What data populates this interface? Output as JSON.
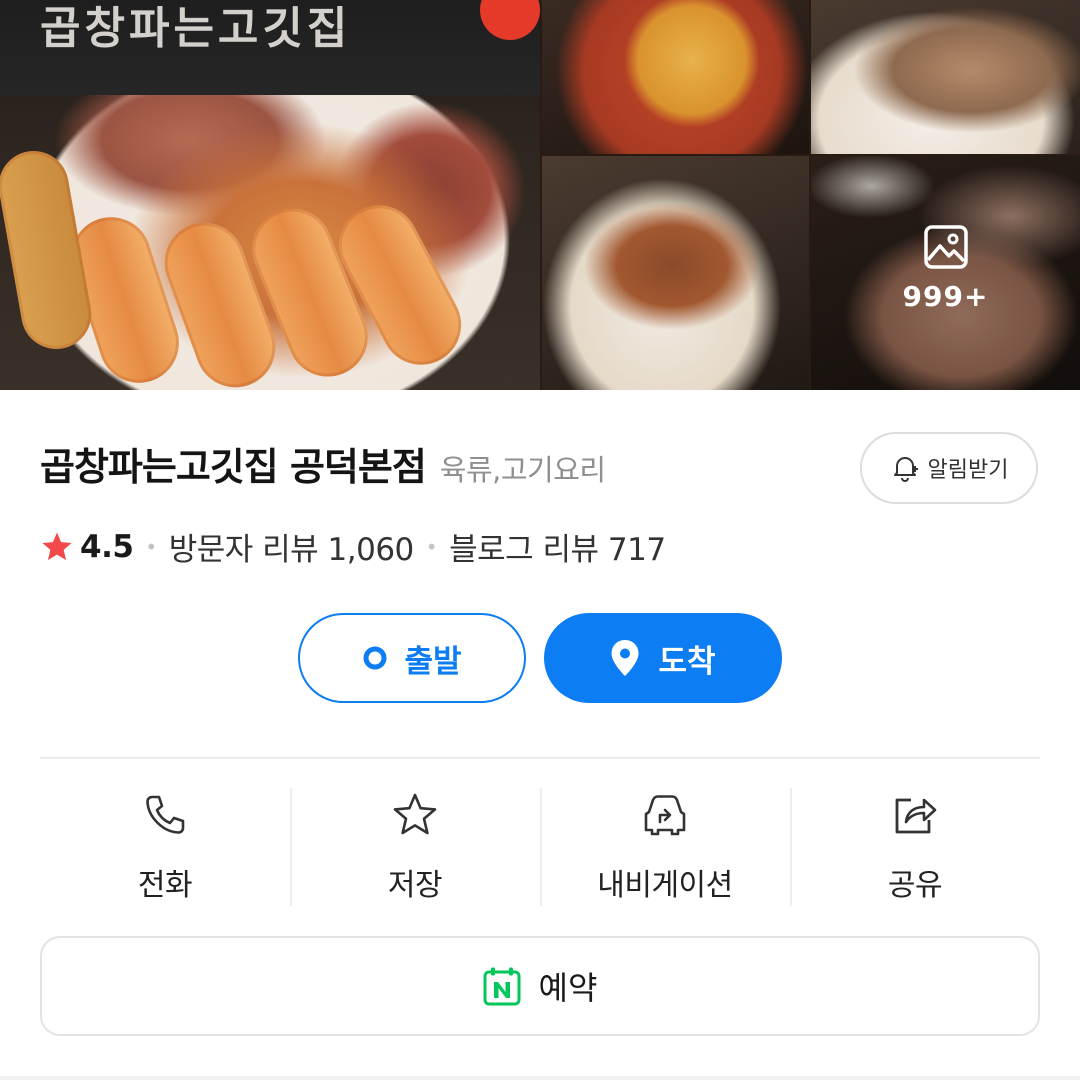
{
  "gallery": {
    "sign_text": "곱창파는고깃집",
    "more_count": "999+"
  },
  "place": {
    "name": "곱창파는고깃집 공덕본점",
    "category": "육류,고기요리",
    "alert_label": "알림받기"
  },
  "rating": {
    "score": "4.5",
    "visitor_reviews": "방문자 리뷰 1,060",
    "blog_reviews": "블로그 리뷰 717"
  },
  "route": {
    "depart_label": "출발",
    "arrive_label": "도착"
  },
  "actions": {
    "call": "전화",
    "save": "저장",
    "navigation": "내비게이션",
    "share": "공유"
  },
  "reservation": {
    "label": "예약"
  },
  "colors": {
    "accent": "#0c7df2",
    "star": "#f24a4a",
    "naver_green": "#03c75a"
  },
  "icons": [
    "image-icon",
    "bell-plus-icon",
    "star-icon",
    "location-dot-icon",
    "map-pin-icon",
    "phone-icon",
    "star-outline-icon",
    "car-navigation-icon",
    "share-icon",
    "naver-calendar-icon"
  ]
}
